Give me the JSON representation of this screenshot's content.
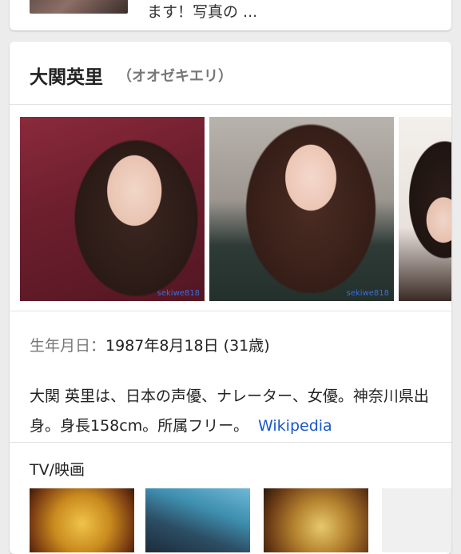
{
  "previous_result": {
    "snippet": "ます！写真の ..."
  },
  "knowledge_panel": {
    "name": "大関英里",
    "reading": "（オオゼキエリ）",
    "images": [
      {
        "watermark": "sekiwe818"
      },
      {
        "watermark": "sekiwe818"
      },
      {
        "watermark": ""
      }
    ],
    "born_label": "生年月日：",
    "born_value": "1987年8月18日 (31歳)",
    "description": "大関 英里は、日本の声優、ナレーター、女優。神奈川県出身。身長158cm。所属フリー。",
    "description_source": "Wikipedia",
    "tv_section_title": "TV/映画"
  }
}
